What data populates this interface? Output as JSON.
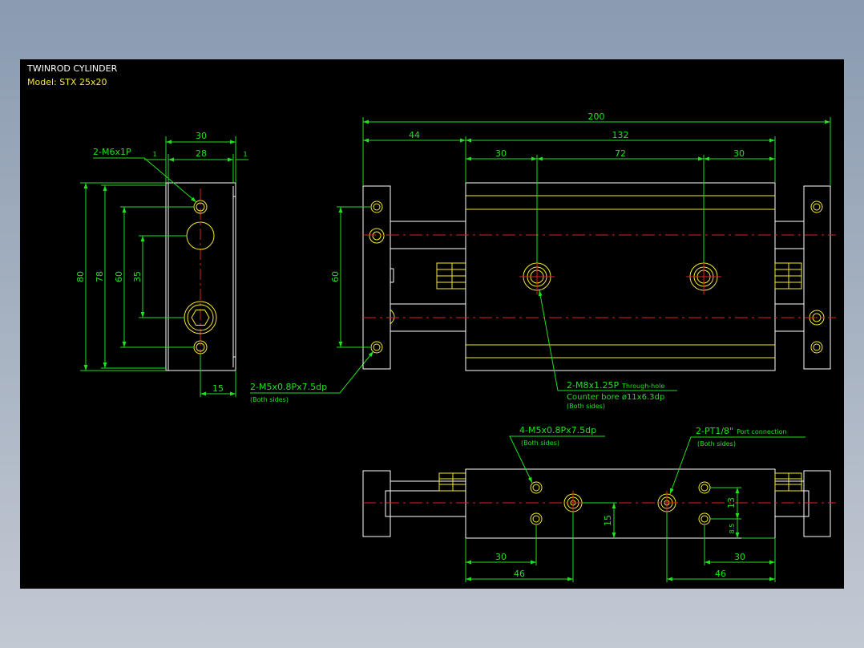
{
  "title": {
    "line1": "TWINROD CYLINDER",
    "line2": "Model: STX 25x20"
  },
  "colors": {
    "background": "#000000",
    "outline": "#ffffff",
    "dimension": "#20e020",
    "feature": "#f5ea2e",
    "centerline": "#e02020"
  },
  "side_view": {
    "dims": {
      "width_30": "30",
      "width_28": "28",
      "gap_left": "1",
      "gap_right": "1",
      "height_80": "80",
      "height_78": "78",
      "height_60": "60",
      "height_35": "35",
      "offset_15": "15"
    },
    "callouts": {
      "top_hole": "2-M6x1P",
      "bottom_hole": "2-M5x0.8Px7.5dp",
      "bottom_hole_sub": "(Both sides)"
    }
  },
  "front_view": {
    "dims": {
      "overall": "200",
      "rod_end": "44",
      "body": "132",
      "left_30": "30",
      "center_72": "72",
      "right_30": "30",
      "plate_60": "60"
    },
    "callout": {
      "line1": "2-M8x1.25P",
      "line1_suffix": "Through-hole",
      "line2": "Counter bore ø11x6.3dp",
      "line3": "(Both sides)"
    }
  },
  "bottom_view": {
    "dims": {
      "left_30": "30",
      "left_46": "46",
      "right_30": "30",
      "right_46": "46",
      "height_15": "15",
      "height_13": "13",
      "height_8_5": "8.5"
    },
    "callouts": {
      "left_main": "4-M5x0.8Px7.5dp",
      "left_sub": "(Both sides)",
      "right_main": "2-PT1/8\"",
      "right_suffix": "Port connection",
      "right_sub": "(Both sides)"
    }
  }
}
